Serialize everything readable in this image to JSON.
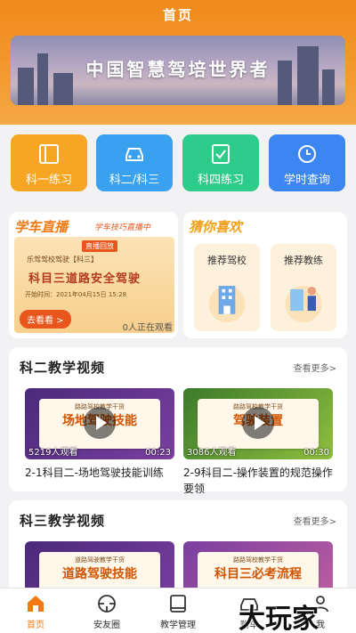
{
  "header": {
    "title": "首页"
  },
  "banner": {
    "text": "中国智慧驾培世界者"
  },
  "quick_actions": [
    {
      "label": "科一练习",
      "icon": "book-icon",
      "color": "#f6a623"
    },
    {
      "label": "科二/科三",
      "icon": "car-icon",
      "color": "#3aa1f0"
    },
    {
      "label": "科四练习",
      "icon": "checklist-icon",
      "color": "#2ecc8a"
    },
    {
      "label": "学时查询",
      "icon": "clock-icon",
      "color": "#3b86f0"
    }
  ],
  "live": {
    "title": "学车直播",
    "tag": "学车技巧直播中",
    "badge": "直播回放",
    "sub": "乐驾驾校驾驶【科三】",
    "main": "科目三道路安全驾驶",
    "time": "开始时间：2021年04月15日 15:28",
    "button": "去看看 >",
    "watching": "0人正在观看"
  },
  "guess": {
    "title": "猜你喜欢",
    "items": [
      {
        "label": "推荐驾校"
      },
      {
        "label": "推荐教练"
      }
    ]
  },
  "section2": {
    "title": "科二教学视频",
    "more": "查看更多>",
    "videos": [
      {
        "header": "路路驾校教学干货",
        "cover": "场地驾驶技能",
        "stat": "5219人观看",
        "duration": "00:23",
        "title": "2-1科目二-场地驾驶技能训练"
      },
      {
        "header": "路路驾校教学干货",
        "cover": "驾驶装置",
        "stat": "3086人观看",
        "duration": "00:30",
        "title": "2-9科目二-操作装置的规范操作要领"
      }
    ]
  },
  "section3": {
    "title": "科三教学视频",
    "more": "查看更多>",
    "videos": [
      {
        "header": "道路驾驶教学干货",
        "cover": "道路驾驶技能"
      },
      {
        "header": "路路驾校教学干货",
        "cover": "科目三必考流程"
      }
    ]
  },
  "tabbar": [
    {
      "label": "首页",
      "icon": "home-icon",
      "active": true
    },
    {
      "label": "安友圈",
      "icon": "steering-wheel-icon",
      "active": false
    },
    {
      "label": "教学管理",
      "icon": "book-icon",
      "active": false
    },
    {
      "label": "购车",
      "icon": "car-icon",
      "active": false
    },
    {
      "label": "我",
      "icon": "user-icon",
      "active": false
    }
  ],
  "watermark": "大玩家"
}
